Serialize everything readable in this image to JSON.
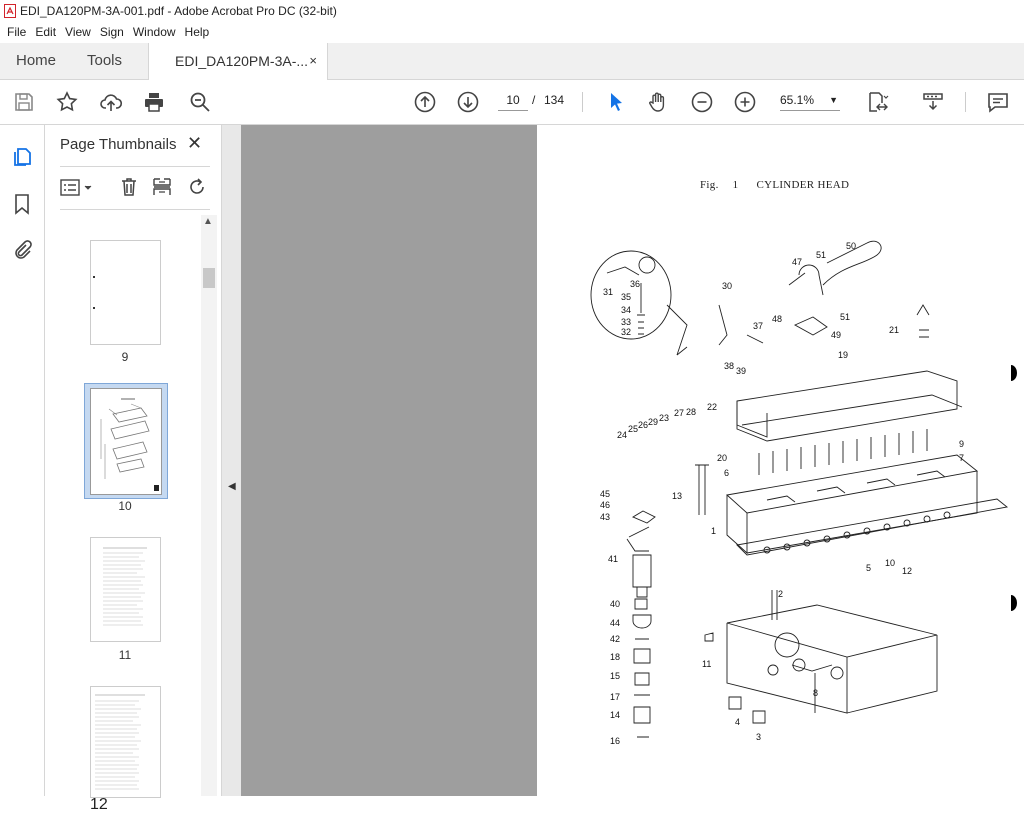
{
  "window": {
    "title": "EDI_DA120PM-3A-001.pdf - Adobe Acrobat Pro DC (32-bit)"
  },
  "menu": [
    "File",
    "Edit",
    "View",
    "Sign",
    "Window",
    "Help"
  ],
  "tabs": {
    "home": "Home",
    "tools": "Tools",
    "document": "EDI_DA120PM-3A-...",
    "close": "×"
  },
  "toolbar": {
    "page_current": "10",
    "page_sep": "/",
    "page_total": "134",
    "zoom": "65.1%"
  },
  "panel": {
    "title": "Page Thumbnails",
    "close": "✕",
    "thumbnails": [
      {
        "label": "9",
        "selected": false
      },
      {
        "label": "10",
        "selected": true
      },
      {
        "label": "11",
        "selected": false
      },
      {
        "label": "12",
        "selected": false
      }
    ]
  },
  "figure": {
    "prefix": "Fig.",
    "number": "1",
    "title": "CYLINDER HEAD",
    "part_labels": [
      "50",
      "51",
      "47",
      "31",
      "36",
      "35",
      "34",
      "33",
      "32",
      "30",
      "48",
      "51",
      "37",
      "49",
      "21",
      "19",
      "38",
      "39",
      "22",
      "28",
      "27",
      "23",
      "29",
      "26",
      "25",
      "24",
      "9",
      "20",
      "7",
      "6",
      "45",
      "13",
      "46",
      "43",
      "1",
      "10",
      "5",
      "12",
      "41",
      "2",
      "40",
      "44",
      "42",
      "11",
      "18",
      "15",
      "17",
      "8",
      "14",
      "4",
      "3",
      "16"
    ]
  },
  "colors": {
    "accent": "#1473e6",
    "canvas": "#9e9e9e",
    "selected_thumb": "#c5d9f1"
  }
}
